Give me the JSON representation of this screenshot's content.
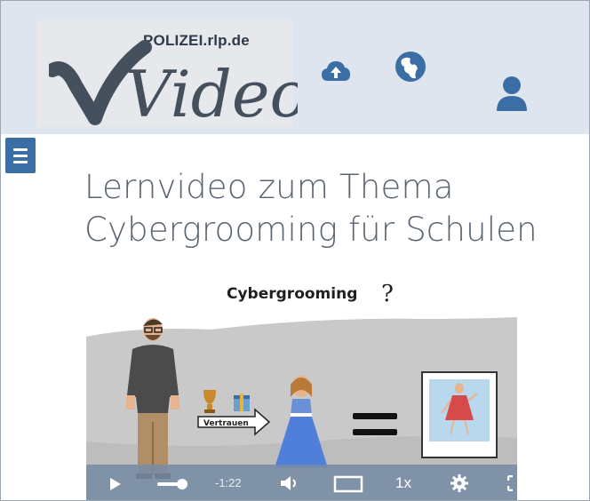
{
  "header": {
    "logo_subtitle": "POLIZEI.rlp.de",
    "logo_text": "Video",
    "icons": [
      "upload-cloud-icon",
      "globe-icon",
      "user-icon"
    ]
  },
  "menu": {
    "icon": "hamburger-menu-icon"
  },
  "page": {
    "title_line1": "Lernvideo zum Thema",
    "title_line2": "Cybergrooming für Schulen"
  },
  "video": {
    "frame_title": "Cybergrooming",
    "frame_title_mark": "?",
    "arrow_label": "Vertrauen",
    "player": {
      "time_remaining": "-1:22",
      "speed": "1x",
      "icons": [
        "play-icon",
        "volume-icon",
        "theater-mode-icon",
        "settings-icon",
        "fullscreen-icon"
      ]
    }
  }
}
